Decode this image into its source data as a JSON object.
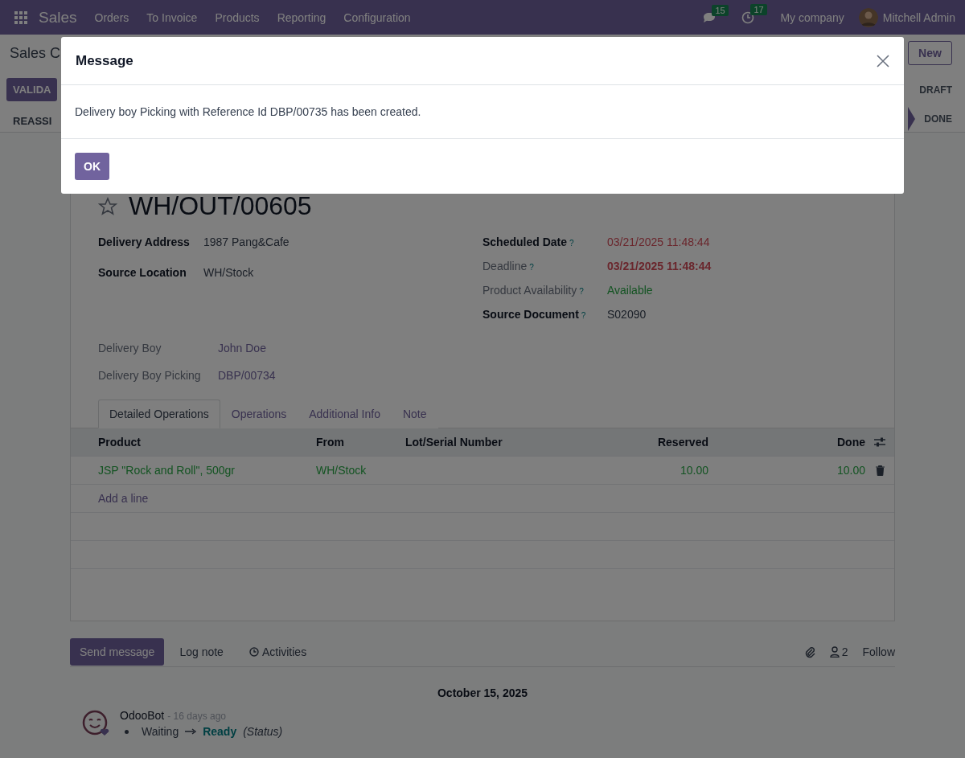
{
  "navbar": {
    "app": "Sales",
    "menu": [
      "Orders",
      "To Invoice",
      "Products",
      "Reporting",
      "Configuration"
    ],
    "messages_count": "15",
    "activities_count": "17",
    "company": "My company",
    "user": "Mitchell Admin"
  },
  "control_panel": {
    "breadcrumb": "Sales C",
    "new_button": "New",
    "buttons": [
      "VALIDA",
      "REASSI"
    ],
    "statusbar": [
      {
        "label": "DRAFT",
        "selected": false
      },
      {
        "label": "DONE",
        "selected": false
      }
    ]
  },
  "record": {
    "title": "WH/OUT/00605",
    "left_fields": [
      {
        "label": "Delivery Address",
        "value": "1987 Pang&Cafe",
        "kind": "strong"
      },
      {
        "label": "Source Location",
        "value": "WH/Stock",
        "kind": "strong"
      }
    ],
    "right_fields": [
      {
        "label": "Scheduled Date",
        "help": "?",
        "value": "03/21/2025 11:48:44",
        "kind": "danger",
        "strong": true
      },
      {
        "label": "Deadline",
        "help": "?",
        "value": "03/21/2025 11:48:44",
        "kind": "danger-bold",
        "strong": false
      },
      {
        "label": "Product Availability",
        "help": "?",
        "value": "Available",
        "kind": "success",
        "strong": false
      },
      {
        "label": "Source Document",
        "help": "?",
        "value": "S02090",
        "kind": "text",
        "strong": true
      }
    ],
    "extra_fields": [
      {
        "label": "Delivery Boy",
        "value": "John Doe",
        "kind": "muted"
      },
      {
        "label": "Delivery Boy Picking",
        "value": "DBP/00734",
        "kind": "muted"
      }
    ],
    "tabs": [
      {
        "label": "Detailed Operations",
        "selected": true
      },
      {
        "label": "Operations",
        "selected": false
      },
      {
        "label": "Additional Info",
        "selected": false
      },
      {
        "label": "Note",
        "selected": false
      }
    ],
    "table": {
      "columns": [
        "Product",
        "From",
        "Lot/Serial Number",
        "Reserved",
        "Done"
      ],
      "rows": [
        {
          "cells": [
            "JSP \"Rock and Roll\", 500gr",
            "WH/Stock",
            "",
            "10.00",
            "10.00"
          ]
        }
      ],
      "add_line": "Add a line"
    }
  },
  "chatter": {
    "actions": [
      {
        "label": "Send message",
        "selected": true
      },
      {
        "label": "Log note",
        "selected": false
      },
      {
        "label": "Activities",
        "selected": false
      }
    ],
    "followers_count": "2",
    "follow": "Follow",
    "date": "October 15, 2025",
    "message": {
      "author": "OdooBot",
      "time": "- 16 days ago",
      "old_value": "Waiting",
      "new_value": "Ready",
      "field": "(Status)"
    }
  },
  "dialog": {
    "title": "Message",
    "body": "Delivery boy Picking with Reference Id DBP/00735 has been created.",
    "ok": "OK"
  }
}
